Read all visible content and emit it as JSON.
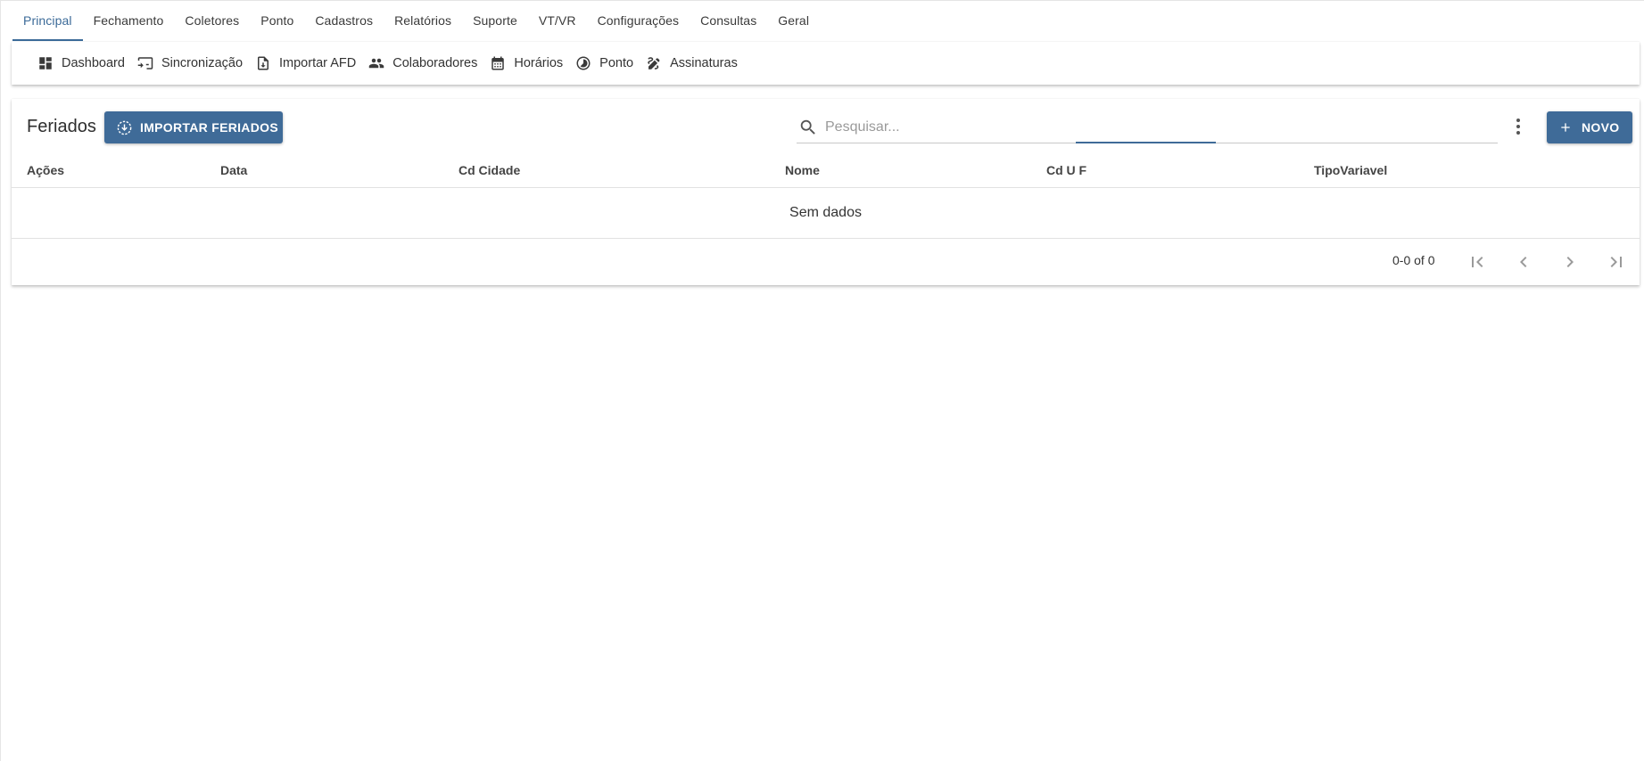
{
  "tabs": [
    {
      "label": "Principal",
      "active": true
    },
    {
      "label": "Fechamento"
    },
    {
      "label": "Coletores"
    },
    {
      "label": "Ponto"
    },
    {
      "label": "Cadastros"
    },
    {
      "label": "Relatórios"
    },
    {
      "label": "Suporte"
    },
    {
      "label": "VT/VR"
    },
    {
      "label": "Configurações"
    },
    {
      "label": "Consultas"
    },
    {
      "label": "Geral"
    }
  ],
  "toolbar": {
    "items": [
      {
        "label": "Dashboard",
        "icon": "dashboard-icon"
      },
      {
        "label": "Sincronização",
        "icon": "sync-screen-icon"
      },
      {
        "label": "Importar AFD",
        "icon": "import-file-icon"
      },
      {
        "label": "Colaboradores",
        "icon": "people-icon"
      },
      {
        "label": "Horários",
        "icon": "calendar-icon"
      },
      {
        "label": "Ponto",
        "icon": "clock-half-icon"
      },
      {
        "label": "Assinaturas",
        "icon": "signature-icon"
      }
    ]
  },
  "card": {
    "title": "Feriados",
    "import_button": "IMPORTAR FERIADOS",
    "new_button": "NOVO",
    "search_placeholder": "Pesquisar...",
    "search_value": ""
  },
  "table": {
    "columns": [
      "Ações",
      "Data",
      "Cd Cidade",
      "Nome",
      "Cd U F",
      "TipoVariavel"
    ],
    "rows": [],
    "empty_text": "Sem dados"
  },
  "pagination": {
    "range_text": "0-0 of 0"
  },
  "colors": {
    "accent": "#3f6b98",
    "active_tab": "#3b6a98"
  }
}
